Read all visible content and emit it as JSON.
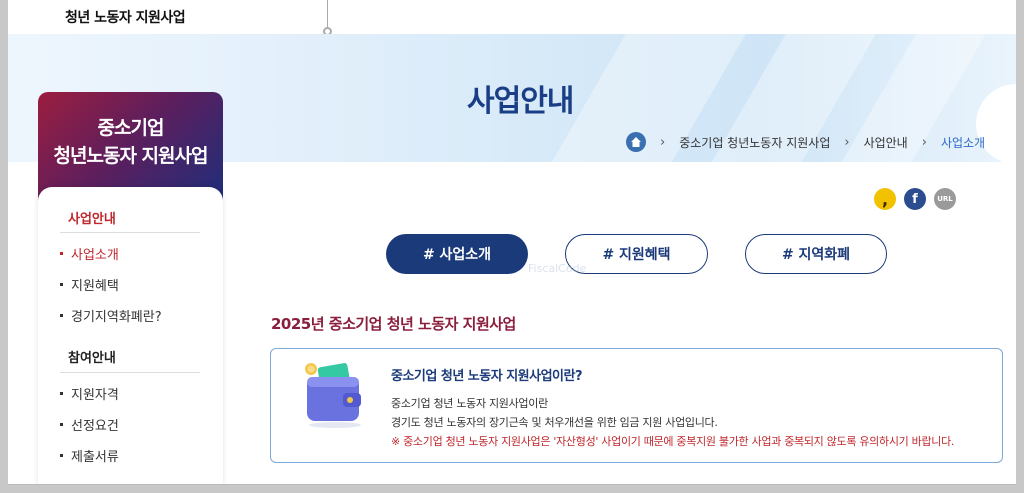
{
  "header": {
    "site_title": "청년 노동자 지원사업"
  },
  "hero": {
    "title": "사업안내",
    "breadcrumb": [
      "중소기업 청년노동자 지원사업",
      "사업안내",
      "사업소개"
    ]
  },
  "sidebar": {
    "title_line1": "중소기업",
    "title_line2": "청년노동자 지원사업",
    "groups": [
      {
        "label": "사업안내",
        "items": [
          "사업소개",
          "지원혜택",
          "경기지역화폐란?"
        ]
      },
      {
        "label": "참여안내",
        "items": [
          "지원자격",
          "선정요건",
          "제출서류"
        ]
      }
    ]
  },
  "share": {
    "kakao": ",",
    "facebook": "f",
    "url": "URL"
  },
  "tabs": [
    "# 사업소개",
    "# 지원혜택",
    "# 지역화폐"
  ],
  "watermark": "FiscalCode",
  "section": {
    "title": "2025년 중소기업 청년 노동자 지원사업",
    "box_heading": "중소기업 청년 노동자 지원사업이란?",
    "line1": "중소기업 청년 노동자 지원사업이란",
    "line2": "경기도 청년 노동자의 장기근속 및 처우개선을 위한 임금 지원 사업입니다.",
    "warning": "※ 중소기업 청년 노동자 지원사업은 '자산형성' 사업이기 때문에 중복지원 불가한 사업과 중복되지 않도록 유의하시기 바랍니다."
  },
  "colors": {
    "navy": "#1b3a7a",
    "accent_red": "#c0272d",
    "section_title": "#8a1e3c"
  }
}
